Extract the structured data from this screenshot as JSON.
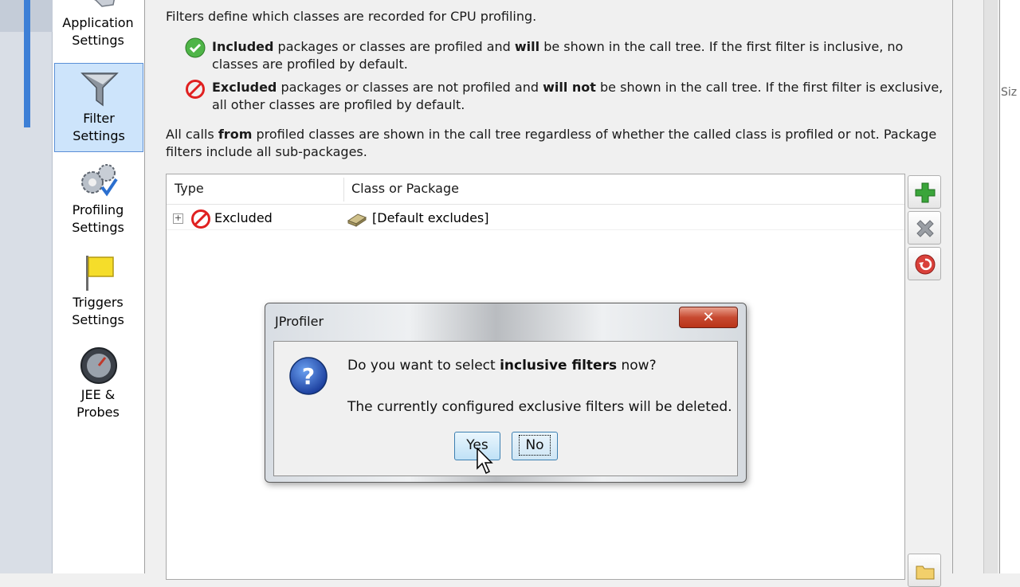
{
  "nav": {
    "items": [
      {
        "label_line1": "Application",
        "label_line2": "Settings",
        "icon": "wrench-icon"
      },
      {
        "label_line1": "Filter",
        "label_line2": "Settings",
        "icon": "funnel-icon",
        "selected": true
      },
      {
        "label_line1": "Profiling",
        "label_line2": "Settings",
        "icon": "gears-icon"
      },
      {
        "label_line1": "Triggers",
        "label_line2": "Settings",
        "icon": "flag-icon"
      },
      {
        "label_line1": "JEE &",
        "label_line2": "Probes",
        "icon": "gauge-icon"
      }
    ]
  },
  "main": {
    "intro": "Filters define which classes are recorded for CPU profiling.",
    "included": {
      "bold1": "Included",
      "text1": " packages or classes are profiled and ",
      "bold2": "will",
      "text2": " be shown in the call tree. If the first filter is inclusive, no",
      "line2": "classes are profiled by default."
    },
    "excluded": {
      "bold1": "Excluded",
      "text1": " packages or classes are not profiled and ",
      "bold2": "will not",
      "text2": " be shown in the call tree. If the first filter is exclusive,",
      "line2": "all other classes are profiled by default."
    },
    "calls": {
      "text1": "All calls ",
      "bold": "from",
      "text2": " profiled classes are shown in the call tree regardless of whether the called class is profiled or not. Package",
      "line2": "filters include all sub-packages."
    }
  },
  "table": {
    "columns": [
      "Type",
      "Class or Package"
    ],
    "rows": [
      {
        "type": "Excluded",
        "value": "[Default excludes]"
      }
    ]
  },
  "side_buttons": [
    "add-icon",
    "remove-icon",
    "reset-icon"
  ],
  "right_partial_text": "Siz",
  "dialog": {
    "title": "JProfiler",
    "close_glyph": "✕",
    "question_pre": "Do you want to select ",
    "question_bold": "inclusive filters",
    "question_post": " now?",
    "warning": "The currently configured exclusive filters will be deleted.",
    "yes": "Yes",
    "no": "No"
  },
  "colors": {
    "selected_bg": "#cde4fb",
    "accent": "#3d7fd6",
    "close_red": "#c74a31",
    "add_green": "#3aa53a"
  }
}
